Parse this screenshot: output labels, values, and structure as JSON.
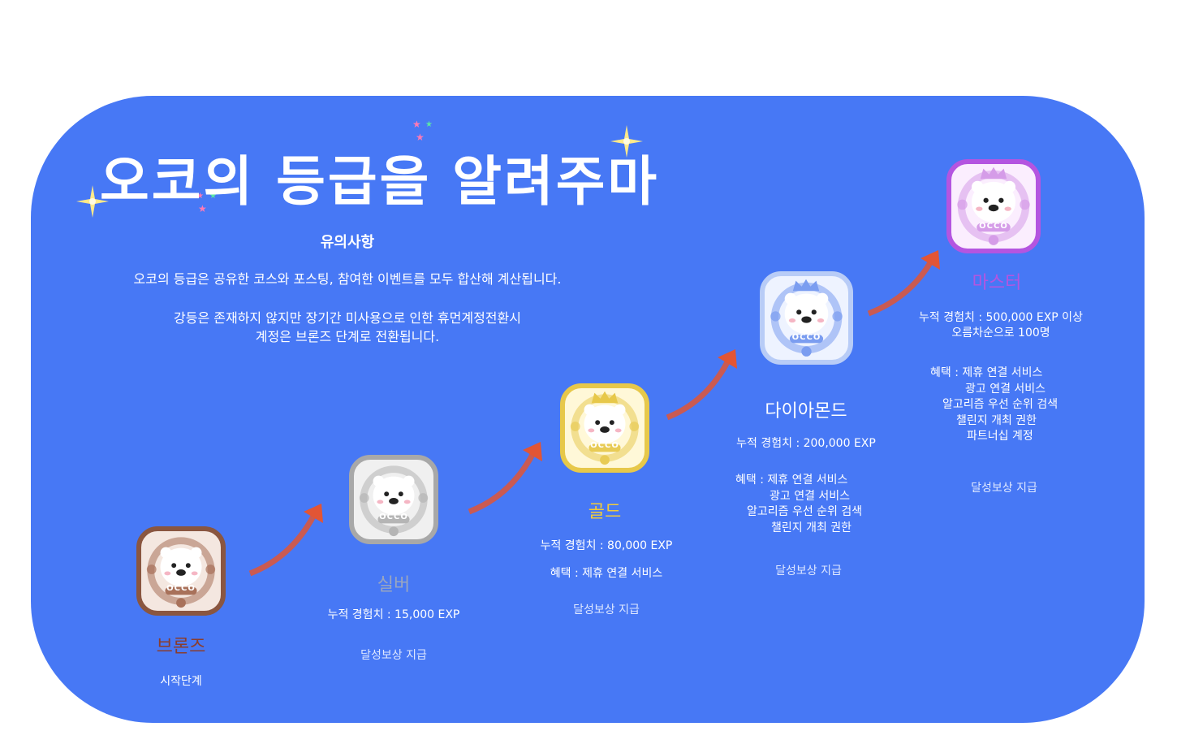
{
  "title": "오코의 등급을 알려주마",
  "notice": {
    "heading": "유의사항",
    "line1": "오코의 등급은 공유한 코스와 포스팅, 참여한 이벤트를 모두 합산해 계산됩니다.",
    "line2": "강등은 존재하지 않지만 장기간 미사용으로 인한 휴먼계정전환시",
    "line3": "계정은 브론즈 단계로 전환됩니다."
  },
  "badge_logo_text": "OCCO",
  "colors": {
    "panel": "#4778f5",
    "bronze": "#8a5640",
    "silver": "#a8a8a8",
    "gold": "#e7c84a",
    "diamond": "#7b9df0",
    "master": "#b455e0",
    "arrow": "#e25535"
  },
  "tiers": [
    {
      "name": "브론즈",
      "desc": "시작단계"
    },
    {
      "name": "실버",
      "exp": "누적 경험치 : 15,000 EXP",
      "reward": "달성보상 지급"
    },
    {
      "name": "골드",
      "exp": "누적 경험치 : 80,000 EXP",
      "benefit": "혜택 : 제휴 연결 서비스",
      "reward": "달성보상 지급"
    },
    {
      "name": "다이아몬드",
      "exp": "누적 경험치 : 200,000 EXP",
      "benefits": [
        "혜택 : 제휴 연결 서비스",
        "광고 연결 서비스",
        "알고리즘 우선 순위 검색",
        "챌린지 개최 권한"
      ],
      "reward": "달성보상 지급"
    },
    {
      "name": "마스터",
      "exp": "누적 경험치 : 500,000 EXP 이상",
      "exp2": "오름차순으로 100명",
      "benefits": [
        "혜택 : 제휴 연결 서비스",
        "광고 연결 서비스",
        "알고리즘 우선 순위 검색",
        "챌린지 개최 권한",
        "파트너십 계정"
      ],
      "reward": "달성보상 지급"
    }
  ]
}
